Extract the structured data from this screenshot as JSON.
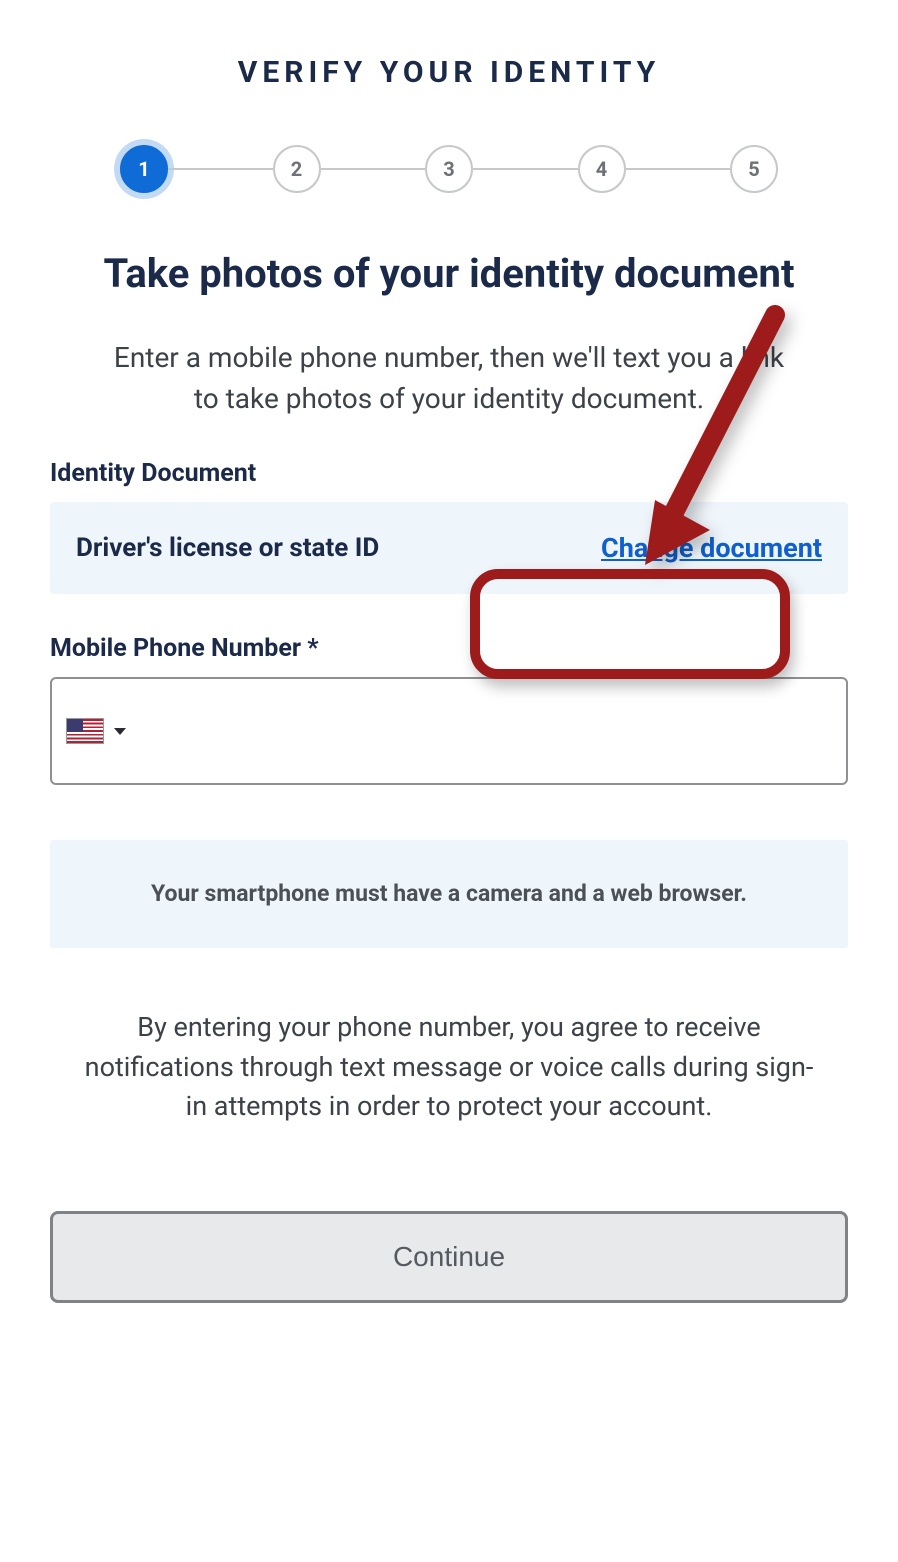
{
  "page_title": "VERIFY YOUR IDENTITY",
  "stepper": {
    "steps": [
      "1",
      "2",
      "3",
      "4",
      "5"
    ],
    "active_index": 0
  },
  "heading": "Take photos of your identity document",
  "subheading": "Enter a mobile phone number, then we'll text you a link to take photos of your identity document.",
  "identity_doc": {
    "label": "Identity Document",
    "selected_type": "Driver's license or state ID",
    "change_link": "Change document"
  },
  "phone": {
    "label": "Mobile Phone Number *",
    "country": "us",
    "value": ""
  },
  "notice": "Your smartphone must have a camera and a web browser.",
  "agreement": "By entering your phone number, you agree to receive notifications through text message or voice calls during sign-in attempts in order to protect your account.",
  "continue_label": "Continue"
}
